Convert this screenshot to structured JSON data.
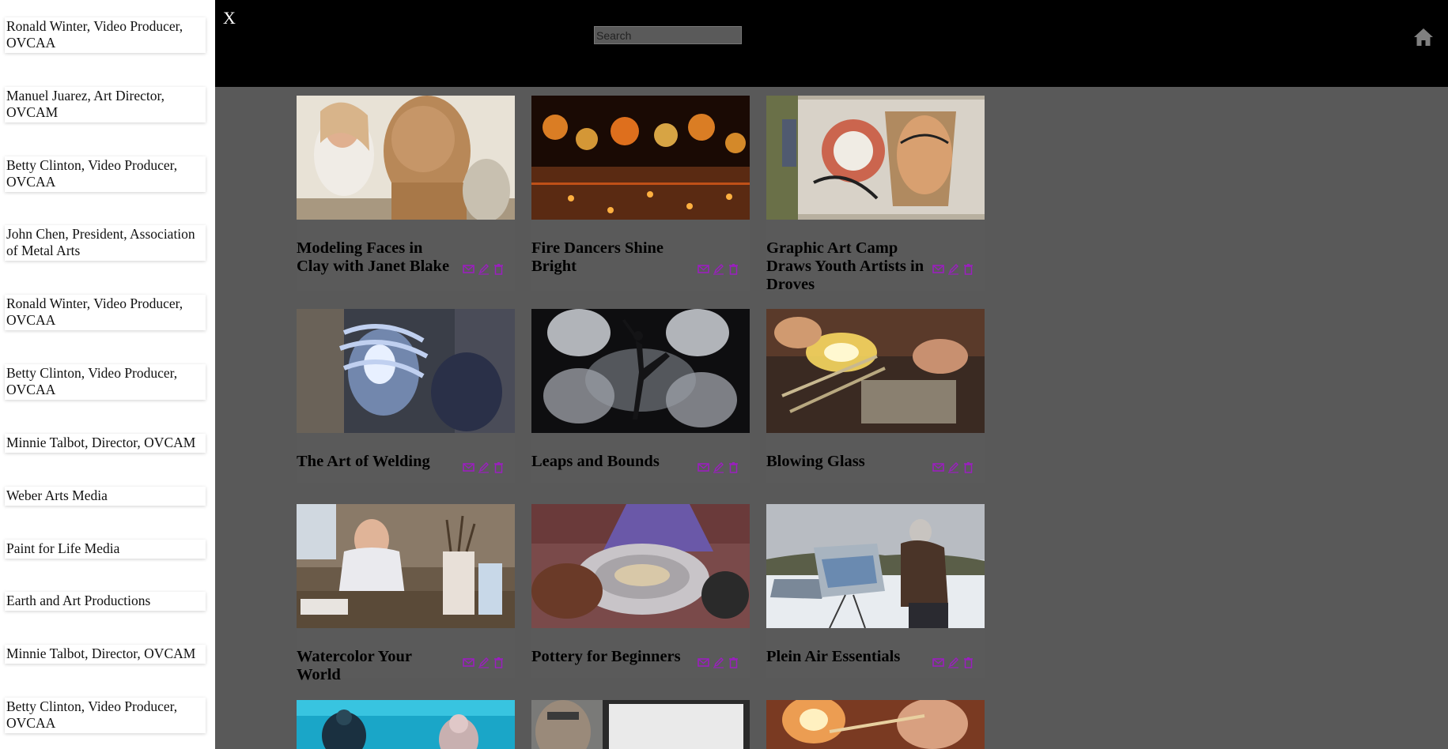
{
  "sidebar": {
    "items": [
      {
        "label": "Ronald Winter, Video Producer, OVCAA"
      },
      {
        "label": "Manuel Juarez, Art Director, OVCAM"
      },
      {
        "label": "Betty Clinton, Video Producer, OVCAA"
      },
      {
        "label": "John Chen, President, Association of Metal Arts"
      },
      {
        "label": "Ronald Winter, Video Producer, OVCAA"
      },
      {
        "label": "Betty Clinton, Video Producer, OVCAA"
      },
      {
        "label": "Minnie Talbot, Director, OVCAM"
      },
      {
        "label": "Weber Arts Media"
      },
      {
        "label": "Paint for Life Media"
      },
      {
        "label": "Earth and Art Productions"
      },
      {
        "label": "Minnie Talbot, Director, OVCAM"
      },
      {
        "label": "Betty Clinton, Video Producer, OVCAA"
      }
    ]
  },
  "header": {
    "close_label": "X",
    "search_placeholder": "Search",
    "home_icon": "home-icon"
  },
  "accent_color": "#9b1fbf",
  "cards": [
    {
      "title": "Modeling Faces in Clay with Janet Blake"
    },
    {
      "title": "Fire Dancers Shine Bright"
    },
    {
      "title": "Graphic Art Camp Draws Youth Artists in Droves"
    },
    {
      "title": "The Art of Welding"
    },
    {
      "title": "Leaps and Bounds"
    },
    {
      "title": "Blowing Glass"
    },
    {
      "title": "Watercolor Your World"
    },
    {
      "title": "Pottery for Beginners"
    },
    {
      "title": "Plein Air Essentials"
    }
  ],
  "card_actions": [
    "email-icon",
    "edit-icon",
    "delete-icon"
  ]
}
